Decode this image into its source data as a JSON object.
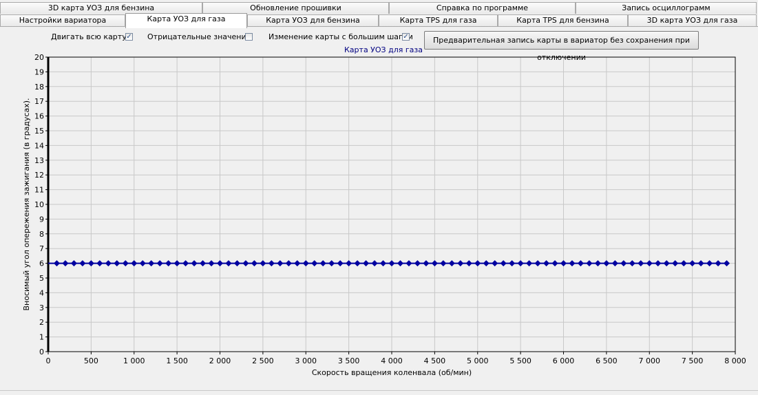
{
  "tabs_row1": [
    {
      "label": "3D карта УОЗ для бензина"
    },
    {
      "label": "Обновление прошивки"
    },
    {
      "label": "Справка по программе"
    },
    {
      "label": "Запись осциллограмм"
    }
  ],
  "tabs_row2": [
    {
      "label": "Настройки вариатора",
      "active": false
    },
    {
      "label": "Карта УОЗ для газа",
      "active": true
    },
    {
      "label": "Карта УОЗ для бензина",
      "active": false
    },
    {
      "label": "Карта TPS для газа",
      "active": false
    },
    {
      "label": "Карта TPS для бензина",
      "active": false
    },
    {
      "label": "3D карта УОЗ для газа",
      "active": false
    }
  ],
  "controls": {
    "move_all": {
      "label": "Двигать всю карту",
      "checked": true
    },
    "negative": {
      "label": "Отрицательные значения",
      "checked": false
    },
    "big_step": {
      "label": "Изменение карты с большим шагом",
      "checked": true
    },
    "chart_name": "Карта УОЗ для газа",
    "write_button": "Предварительная запись карты в вариатор без сохранения при отключении"
  },
  "colors": {
    "series": "#0000a0",
    "grid": "#c8c8c8",
    "tab_active": "#ffffff"
  },
  "chart_data": {
    "type": "line",
    "title": "",
    "xlabel": "Скорость вращения коленвала (об/мин)",
    "ylabel": "Вносимый угол опережения зажигания (в градусах).",
    "xlim": [
      0,
      8000
    ],
    "ylim": [
      0,
      20
    ],
    "xticks": [
      "0",
      "500",
      "1 000",
      "1 500",
      "2 000",
      "2 500",
      "3 000",
      "3 500",
      "4 000",
      "4 500",
      "5 000",
      "5 500",
      "6 000",
      "6 500",
      "7 000",
      "7 500",
      "8 000"
    ],
    "yticks": [
      "0",
      "1",
      "2",
      "3",
      "4",
      "5",
      "6",
      "7",
      "8",
      "9",
      "10",
      "11",
      "12",
      "13",
      "14",
      "15",
      "16",
      "17",
      "18",
      "19",
      "20"
    ],
    "grid": true,
    "series": [
      {
        "x": [
          100,
          200,
          300,
          400,
          500,
          600,
          700,
          800,
          900,
          1000,
          1100,
          1200,
          1300,
          1400,
          1500,
          1600,
          1700,
          1800,
          1900,
          2000,
          2100,
          2200,
          2300,
          2400,
          2500,
          2600,
          2700,
          2800,
          2900,
          3000,
          3100,
          3200,
          3300,
          3400,
          3500,
          3600,
          3700,
          3800,
          3900,
          4000,
          4100,
          4200,
          4300,
          4400,
          4500,
          4600,
          4700,
          4800,
          4900,
          5000,
          5100,
          5200,
          5300,
          5400,
          5500,
          5600,
          5700,
          5800,
          5900,
          6000,
          6100,
          6200,
          6300,
          6400,
          6500,
          6600,
          6700,
          6800,
          6900,
          7000,
          7100,
          7200,
          7300,
          7400,
          7500,
          7600,
          7700,
          7800,
          7900
        ],
        "y": [
          6,
          6,
          6,
          6,
          6,
          6,
          6,
          6,
          6,
          6,
          6,
          6,
          6,
          6,
          6,
          6,
          6,
          6,
          6,
          6,
          6,
          6,
          6,
          6,
          6,
          6,
          6,
          6,
          6,
          6,
          6,
          6,
          6,
          6,
          6,
          6,
          6,
          6,
          6,
          6,
          6,
          6,
          6,
          6,
          6,
          6,
          6,
          6,
          6,
          6,
          6,
          6,
          6,
          6,
          6,
          6,
          6,
          6,
          6,
          6,
          6,
          6,
          6,
          6,
          6,
          6,
          6,
          6,
          6,
          6,
          6,
          6,
          6,
          6,
          6,
          6,
          6,
          6,
          6
        ]
      }
    ]
  }
}
